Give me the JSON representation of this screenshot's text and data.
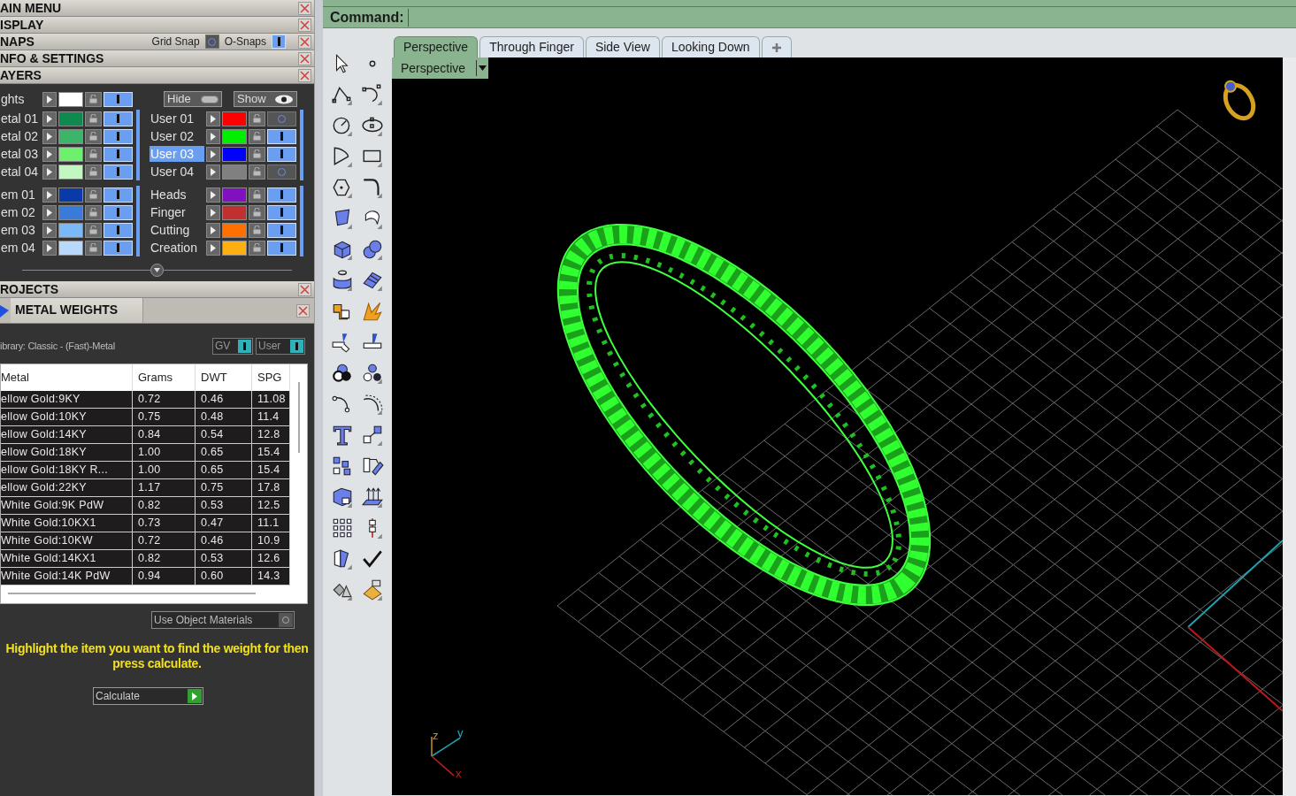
{
  "main_panels": [
    {
      "title": "AIN MENU"
    },
    {
      "title": "ISPLAY"
    },
    {
      "title": "NAPS",
      "toggles": [
        {
          "label": "Grid Snap",
          "on": false
        },
        {
          "label": "O-Snaps",
          "on": true
        }
      ]
    },
    {
      "title": "NFO & SETTINGS"
    },
    {
      "title": "AYERS"
    }
  ],
  "layers": {
    "top": {
      "name": "ghts",
      "color": "#ffffff",
      "visible": true,
      "selected": false
    },
    "hide_label": "Hide",
    "show_label": "Show",
    "left_groups": [
      [
        {
          "name": "etal 01",
          "color": "#0e8a4e",
          "visible": true,
          "selected": false
        },
        {
          "name": "etal 02",
          "color": "#3cb46a",
          "visible": true,
          "selected": false
        },
        {
          "name": "etal 03",
          "color": "#6ef06e",
          "visible": true,
          "selected": false
        },
        {
          "name": "etal 04",
          "color": "#c0f8c0",
          "visible": true,
          "selected": false
        }
      ],
      [
        {
          "name": "em 01",
          "color": "#0a3aa8",
          "visible": true,
          "selected": false
        },
        {
          "name": "em 02",
          "color": "#3a7ad8",
          "visible": true,
          "selected": false
        },
        {
          "name": "em 03",
          "color": "#7ab8f8",
          "visible": true,
          "selected": false
        },
        {
          "name": "em 04",
          "color": "#b8d8fc",
          "visible": true,
          "selected": false
        }
      ]
    ],
    "right_groups": [
      [
        {
          "name": "User 01",
          "color": "#ff0000",
          "visible": false,
          "selected": false
        },
        {
          "name": "User 02",
          "color": "#00ee00",
          "visible": true,
          "selected": false
        },
        {
          "name": "User 03",
          "color": "#0000ff",
          "visible": true,
          "selected": true
        },
        {
          "name": "User 04",
          "color": "#808080",
          "visible": false,
          "selected": false
        }
      ],
      [
        {
          "name": "Heads",
          "color": "#8010c0",
          "visible": true,
          "selected": false
        },
        {
          "name": "Finger",
          "color": "#c03030",
          "visible": true,
          "selected": false
        },
        {
          "name": "Cutting",
          "color": "#ff7000",
          "visible": true,
          "selected": false
        },
        {
          "name": "Creation",
          "color": "#ffb010",
          "visible": true,
          "selected": false
        }
      ]
    ]
  },
  "projects": {
    "title": "ROJECTS"
  },
  "metal_weights": {
    "title": "METAL WEIGHTS",
    "library": "ibrary: Classic - (Fast)-Metal",
    "toggles": [
      {
        "label": "GV",
        "on": true
      },
      {
        "label": "User",
        "on": true
      }
    ],
    "table": {
      "columns": [
        "Metal",
        "Grams",
        "DWT",
        "SPG"
      ],
      "rows": [
        [
          "ellow Gold:9KY",
          "0.72",
          "0.46",
          "11.08"
        ],
        [
          "ellow Gold:10KY",
          "0.75",
          "0.48",
          "11.4"
        ],
        [
          "ellow Gold:14KY",
          "0.84",
          "0.54",
          "12.8"
        ],
        [
          "ellow Gold:18KY",
          "1.00",
          "0.65",
          "15.4"
        ],
        [
          "ellow Gold:18KY R...",
          "1.00",
          "0.65",
          "15.4"
        ],
        [
          "ellow Gold:22KY",
          "1.17",
          "0.75",
          "17.8"
        ],
        [
          "White Gold:9K PdW",
          "0.82",
          "0.53",
          "12.5"
        ],
        [
          "White Gold:10KX1",
          "0.73",
          "0.47",
          "11.1"
        ],
        [
          "White Gold:10KW",
          "0.72",
          "0.46",
          "10.9"
        ],
        [
          "White Gold:14KX1",
          "0.82",
          "0.53",
          "12.6"
        ],
        [
          "White Gold:14K PdW",
          "0.94",
          "0.60",
          "14.3"
        ]
      ]
    },
    "use_object_materials": {
      "label": "Use Object Materials",
      "on": false
    },
    "message": "Highlight the item you want to find the weight for then press calculate.",
    "calculate_button": "Calculate"
  },
  "command": {
    "label": "Command:"
  },
  "tabs": [
    {
      "label": "Perspective",
      "selected": true
    },
    {
      "label": "Through Finger",
      "selected": false
    },
    {
      "label": "Side View",
      "selected": false
    },
    {
      "label": "Looking Down",
      "selected": false
    }
  ],
  "view_menu": {
    "label": "Perspective"
  },
  "axes": [
    "z",
    "y",
    "x"
  ]
}
